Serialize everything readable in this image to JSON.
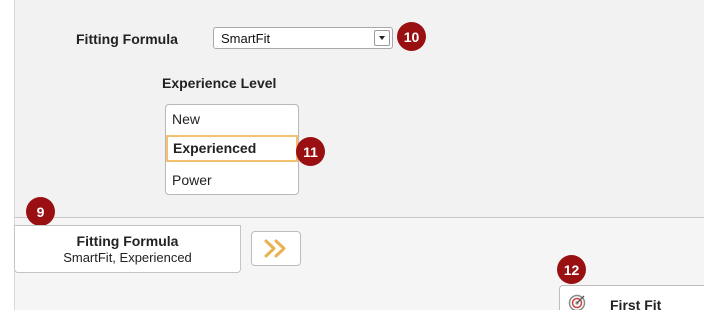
{
  "fitting_formula": {
    "label": "Fitting Formula",
    "selected": "SmartFit"
  },
  "experience_level": {
    "label": "Experience Level",
    "options": [
      "New",
      "Experienced",
      "Power"
    ],
    "selected": "Experienced"
  },
  "summary_tab": {
    "title": "Fitting Formula",
    "value": "SmartFit, Experienced"
  },
  "first_fit": {
    "label": "First Fit"
  },
  "callouts": {
    "c9": "9",
    "c10": "10",
    "c11": "11",
    "c12": "12"
  },
  "colors": {
    "badge": "#990f12",
    "selection_border": "#f3c071",
    "chevron": "#e8b24f",
    "panel": "#f2f2f2"
  },
  "icons": {
    "dropdown": "chevron-down-icon",
    "next": "double-chevron-right-icon",
    "first_fit": "target-icon"
  }
}
